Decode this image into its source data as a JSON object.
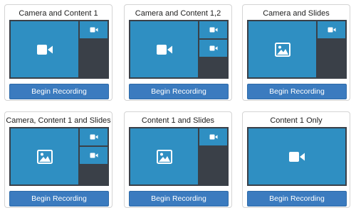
{
  "colors": {
    "preview_bg": "#3a4048",
    "pane_blue": "#2f8fc2",
    "button_blue": "#3b7bbf",
    "icon_white": "#ffffff"
  },
  "layouts": [
    {
      "title": "Camera and Content 1",
      "button": "Begin Recording",
      "main_icon": "video-camera-icon",
      "thumbs": [
        "video-camera-icon"
      ]
    },
    {
      "title": "Camera and Content 1,2",
      "button": "Begin Recording",
      "main_icon": "video-camera-icon",
      "thumbs": [
        "video-camera-icon",
        "video-camera-icon"
      ]
    },
    {
      "title": "Camera and Slides",
      "button": "Begin Recording",
      "main_icon": "image-icon",
      "thumbs": [
        "video-camera-icon"
      ]
    },
    {
      "title": "Camera, Content 1 and Slides",
      "button": "Begin Recording",
      "main_icon": "image-icon",
      "thumbs": [
        "video-camera-icon",
        "video-camera-icon"
      ]
    },
    {
      "title": "Content 1 and Slides",
      "button": "Begin Recording",
      "main_icon": "image-icon",
      "thumbs": [
        "video-camera-icon"
      ]
    },
    {
      "title": "Content 1 Only",
      "button": "Begin Recording",
      "main_icon": "video-camera-icon",
      "thumbs": []
    }
  ]
}
